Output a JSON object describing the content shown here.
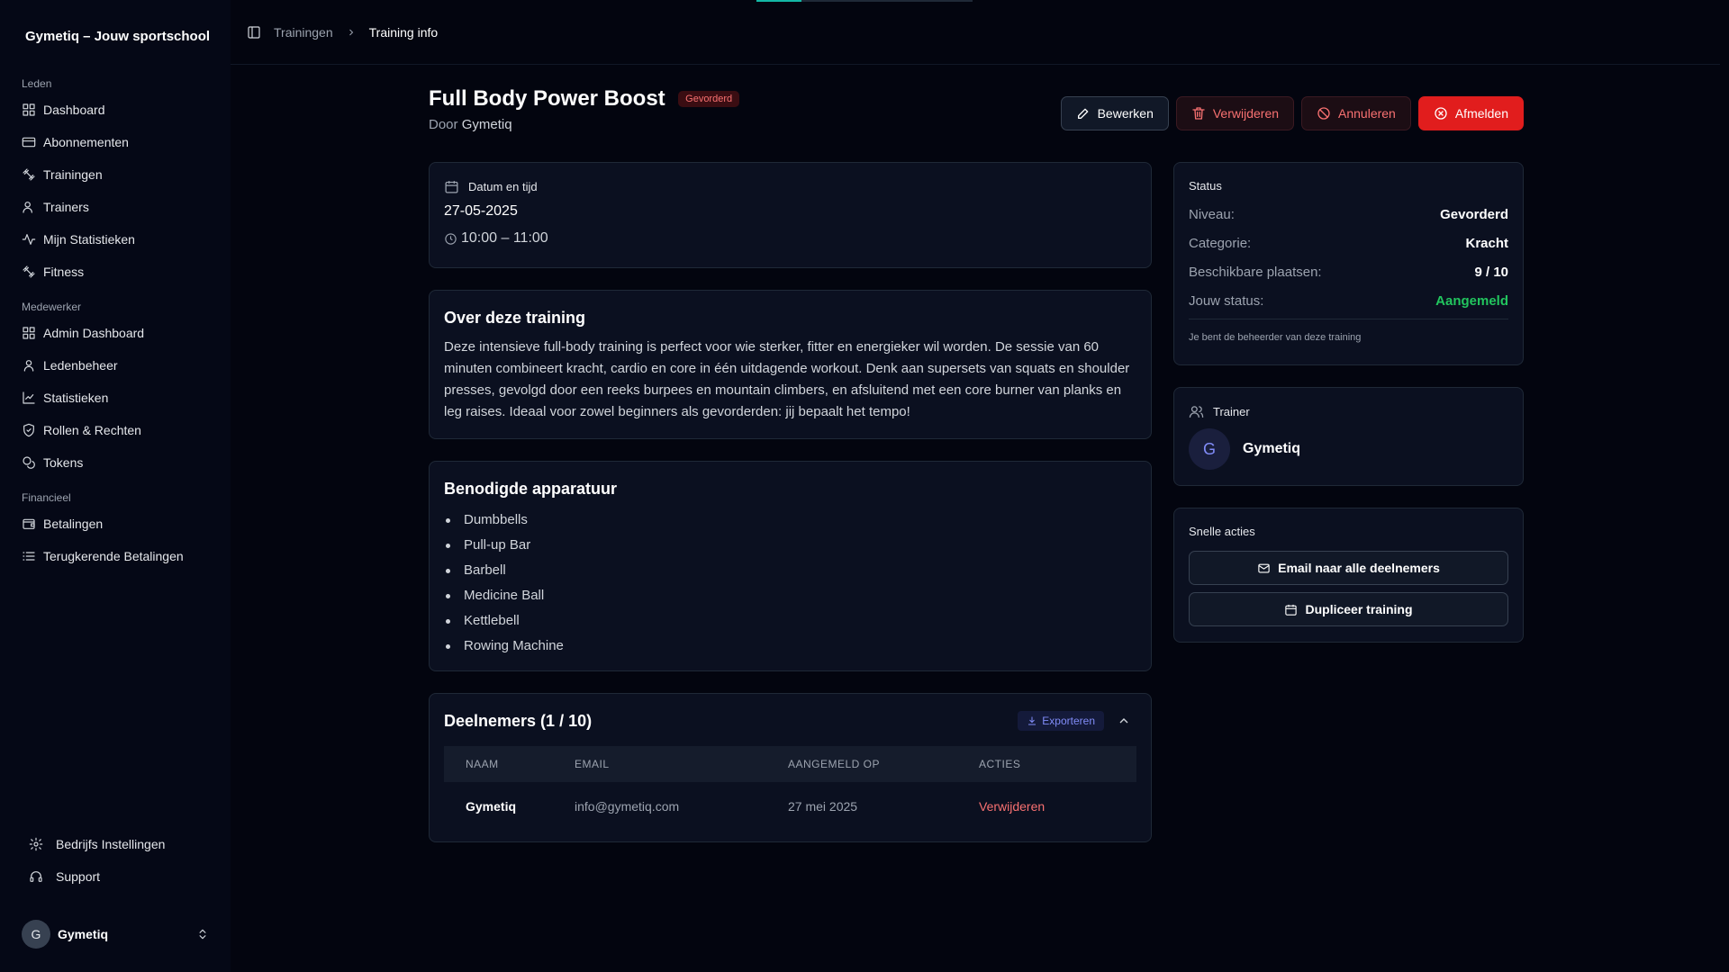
{
  "brand": "Gymetiq – Jouw sportschool",
  "sidebar": {
    "groups": [
      {
        "label": "Leden",
        "items": [
          "Dashboard",
          "Abonnementen",
          "Trainingen",
          "Trainers",
          "Mijn Statistieken",
          "Fitness"
        ]
      },
      {
        "label": "Medewerker",
        "items": [
          "Admin Dashboard",
          "Ledenbeheer",
          "Statistieken",
          "Rollen & Rechten",
          "Tokens"
        ]
      },
      {
        "label": "Financieel",
        "items": [
          "Betalingen",
          "Terugkerende Betalingen"
        ]
      }
    ],
    "bottom": {
      "settings": "Bedrijfs Instellingen",
      "support": "Support"
    },
    "user": {
      "initial": "G",
      "name": "Gymetiq"
    }
  },
  "breadcrumb": {
    "parent": "Trainingen",
    "current": "Training info"
  },
  "training": {
    "title": "Full Body Power Boost",
    "level_badge": "Gevorderd",
    "by_prefix": "Door",
    "by_name": "Gymetiq"
  },
  "actions": {
    "edit": "Bewerken",
    "delete": "Verwijderen",
    "cancel": "Annuleren",
    "signoff": "Afmelden"
  },
  "datetime": {
    "label": "Datum en tijd",
    "date": "27-05-2025",
    "time": "10:00 – 11:00"
  },
  "about": {
    "title": "Over deze training",
    "text": "Deze intensieve full-body training is perfect voor wie sterker, fitter en energieker wil worden. De sessie van 60 minuten combineert kracht, cardio en core in één uitdagende workout. Denk aan supersets van squats en shoulder presses, gevolgd door een reeks burpees en mountain climbers, en afsluitend met een core burner van planks en leg raises. Ideaal voor zowel beginners als gevorderden: jij bepaalt het tempo!"
  },
  "equipment": {
    "title": "Benodigde apparatuur",
    "items": [
      "Dumbbells",
      "Pull-up Bar",
      "Barbell",
      "Medicine Ball",
      "Kettlebell",
      "Rowing Machine"
    ]
  },
  "participants": {
    "title": "Deelnemers (1 / 10)",
    "export": "Exporteren",
    "columns": [
      "NAAM",
      "EMAIL",
      "AANGEMELD OP",
      "ACTIES"
    ],
    "rows": [
      {
        "name": "Gymetiq",
        "email": "info@gymetiq.com",
        "date": "27 mei 2025",
        "action": "Verwijderen"
      }
    ]
  },
  "status": {
    "title": "Status",
    "rows": [
      {
        "key": "Niveau:",
        "value": "Gevorderd"
      },
      {
        "key": "Categorie:",
        "value": "Kracht"
      },
      {
        "key": "Beschikbare plaatsen:",
        "value": "9 / 10"
      },
      {
        "key": "Jouw status:",
        "value": "Aangemeld"
      }
    ],
    "note": "Je bent de beheerder van deze training",
    "status_color": "#22c55e"
  },
  "trainer": {
    "label": "Trainer",
    "initial": "G",
    "name": "Gymetiq"
  },
  "quick_actions": {
    "title": "Snelle acties",
    "email_all": "Email naar alle deelnemers",
    "duplicate": "Dupliceer training"
  },
  "colors": {
    "accent_red": "#e11d1d",
    "accent_indigo": "#818cf8",
    "success": "#22c55e"
  }
}
